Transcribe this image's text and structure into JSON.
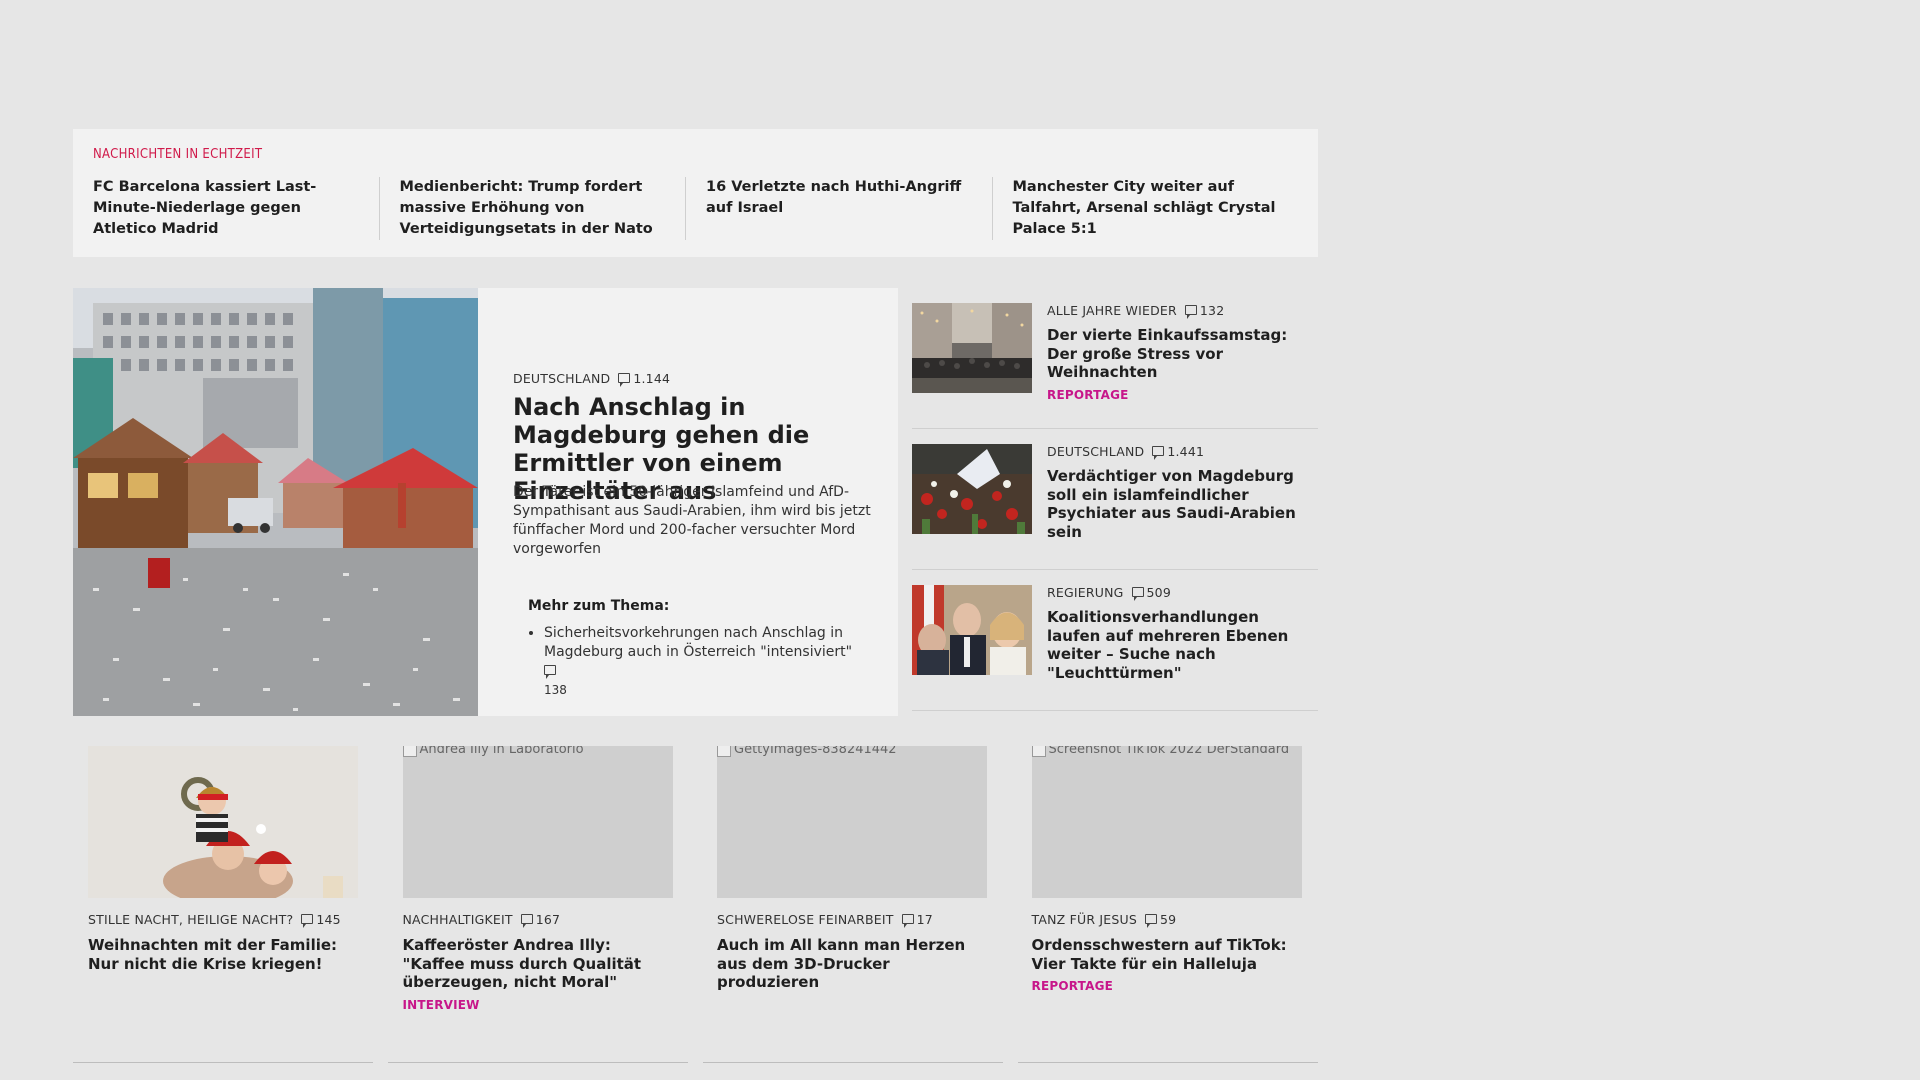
{
  "ticker": {
    "heading": "NACHRICHTEN IN ECHTZEIT",
    "items": [
      "FC Barcelona kassiert Last-Minute-Niederlage gegen Atletico Madrid",
      "Medienbericht: Trump fordert mas­sive Erhöhung von Verteidigungsetats in der Nato",
      "16 Verletzte nach Huthi-Angriff auf Israel",
      "Manchester City weiter auf Talfahrt, Arsenal schlägt Crystal Palace 5:1"
    ]
  },
  "lead": {
    "category": "DEUTSCHLAND",
    "comments": "1.144",
    "title": "Nach Anschlag in Magdeburg gehen die Ermittler von einem Einzeltäter aus",
    "teaser": "Der Täter ist ein 50-jähriger Islamfeind und AfD-Sympathisant aus Saudi-Arabien, ihm wird bis jetzt fünffacher Mord und 200-facher versuchter Mord vorgeworfen",
    "related_heading": "Mehr zum Thema:",
    "related_item": "Sicherheitsvorkehrungen nach Anschlag in Magdeburg auch in Österreich \"intensiviert\"",
    "related_comments": "138"
  },
  "side": [
    {
      "category": "ALLE JAHRE WIEDER",
      "comments": "132",
      "title": "Der vierte Einkaufssamstag: Der große Stress vor Weihnachten",
      "kicker": "REPORTAGE"
    },
    {
      "category": "DEUTSCHLAND",
      "comments": "1.441",
      "title": "Verdächtiger von Magdeburg soll ein islamfeindlicher Psychiater aus Saudi-Arabien sein",
      "kicker": ""
    },
    {
      "category": "REGIERUNG",
      "comments": "509",
      "title": "Koalitionsverhandlungen laufen auf mehreren Ebenen weiter – Suche nach \"Leuchttürmen\"",
      "kicker": ""
    }
  ],
  "cards": [
    {
      "alt": "",
      "category": "STILLE NACHT, HEILIGE NACHT?",
      "comments": "145",
      "title": "Weihnachten mit der Familie: Nur nicht die Krise kriegen!",
      "kicker": ""
    },
    {
      "alt": "Andrea Illy in Laboratorio",
      "category": "NACHHALTIGKEIT",
      "comments": "167",
      "title": "Kaffeeröster Andrea Illy: \"Kaffee muss durch Qualität überzeugen, nicht Moral\"",
      "kicker": "INTERVIEW"
    },
    {
      "alt": "GettyImages-838241442",
      "category": "SCHWERELOSE FEINARBEIT",
      "comments": "17",
      "title": "Auch im All kann man Herzen aus dem 3D-Drucker produzieren",
      "kicker": ""
    },
    {
      "alt": "Screenshot TikTok 2022 DerStandard",
      "category": "TANZ FÜR JESUS",
      "comments": "59",
      "title": "Ordensschwestern auf TikTok: Vier Takte für ein Halleluja",
      "kicker": "REPORTAGE"
    }
  ]
}
